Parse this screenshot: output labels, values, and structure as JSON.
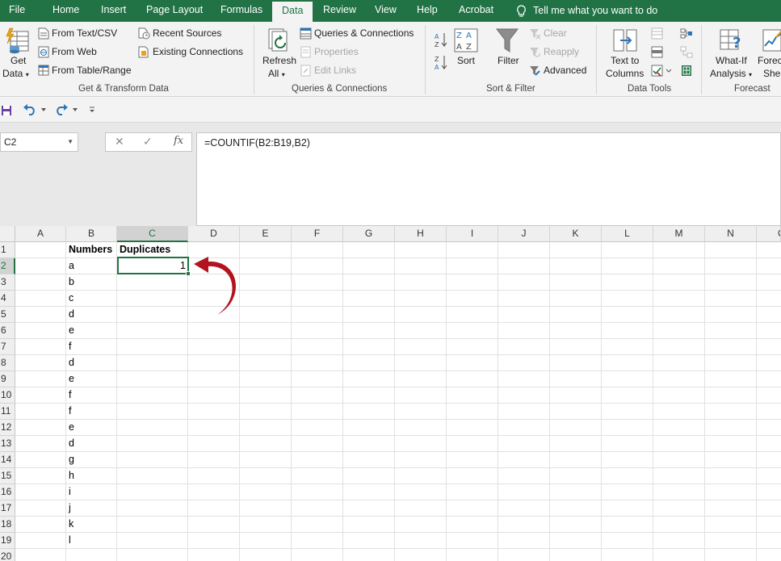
{
  "tabs": [
    "File",
    "Home",
    "Insert",
    "Page Layout",
    "Formulas",
    "Data",
    "Review",
    "View",
    "Help",
    "Acrobat"
  ],
  "active_tab": "Data",
  "tell_me": "Tell me what you want to do",
  "ribbon": {
    "get_transform": {
      "get_data": [
        "Get",
        "Data"
      ],
      "from_text_csv": "From Text/CSV",
      "from_web": "From Web",
      "from_table_range": "From Table/Range",
      "recent_sources": "Recent Sources",
      "existing_connections": "Existing Connections",
      "group_label": "Get & Transform Data"
    },
    "queries": {
      "refresh_all": [
        "Refresh",
        "All"
      ],
      "queries_connections": "Queries & Connections",
      "properties": "Properties",
      "edit_links": "Edit Links",
      "group_label": "Queries & Connections"
    },
    "sort_filter": {
      "sort": "Sort",
      "filter": "Filter",
      "clear": "Clear",
      "reapply": "Reapply",
      "advanced": "Advanced",
      "group_label": "Sort & Filter"
    },
    "data_tools": {
      "text_to_columns": [
        "Text to",
        "Columns"
      ],
      "group_label": "Data Tools"
    },
    "forecast": {
      "what_if": [
        "What-If",
        "Analysis"
      ],
      "forecast_sheet": [
        "Forec",
        "Shee"
      ],
      "group_label": "Forecast"
    }
  },
  "name_box": "C2",
  "formula": "=COUNTIF(B2:B19,B2)",
  "columns": [
    "A",
    "B",
    "C",
    "D",
    "E",
    "F",
    "G",
    "H",
    "I",
    "J",
    "K",
    "L",
    "M",
    "N",
    "O"
  ],
  "rows": [
    "1",
    "2",
    "3",
    "4",
    "5",
    "6",
    "7",
    "8",
    "9",
    "10",
    "11",
    "12",
    "13",
    "14",
    "15",
    "16",
    "17",
    "18",
    "19",
    "20"
  ],
  "selected_column": "C",
  "selected_row": "2",
  "cells": {
    "B1": "Numbers",
    "C1": "Duplicates",
    "C2": "1",
    "B_values": [
      "a",
      "b",
      "c",
      "d",
      "e",
      "f",
      "d",
      "e",
      "f",
      "f",
      "e",
      "d",
      "g",
      "h",
      "i",
      "j",
      "k",
      "l"
    ]
  },
  "colors": {
    "accent": "#217346",
    "arrow": "#b3121f"
  }
}
